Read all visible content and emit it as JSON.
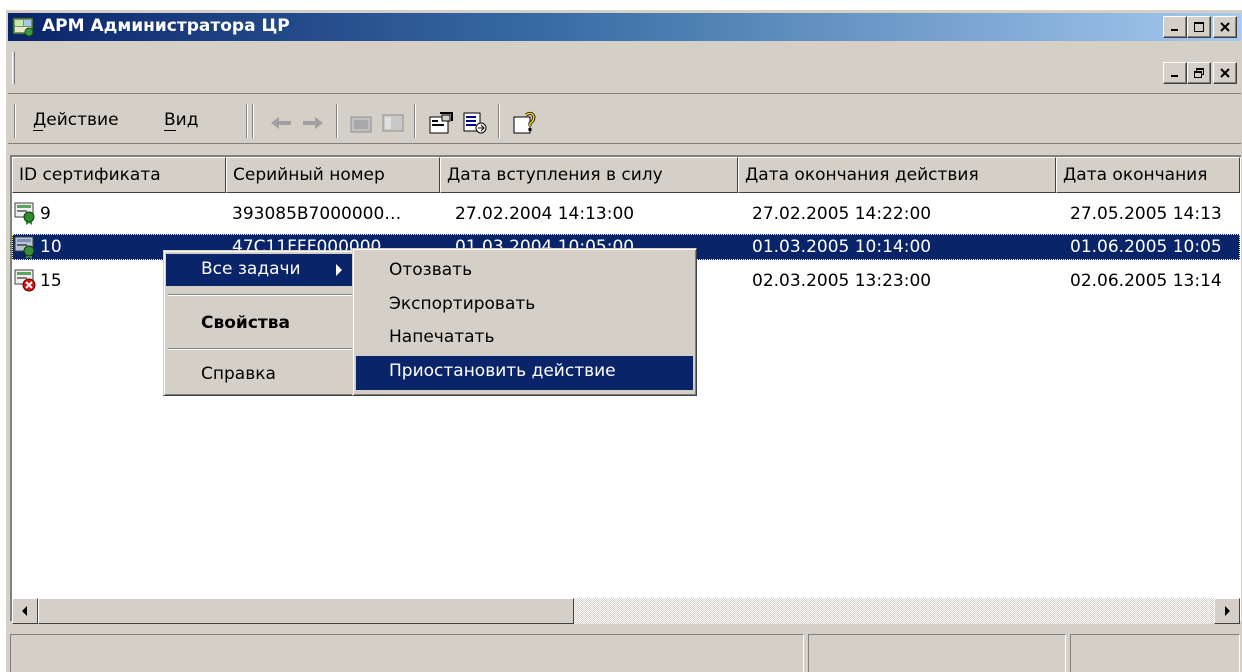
{
  "window": {
    "title": "АРМ Администратора ЦР",
    "caption_buttons": [
      "minimize-icon",
      "maximize-icon",
      "close-icon"
    ],
    "mdi_buttons": [
      "minimize-icon",
      "restore-icon",
      "close-icon"
    ]
  },
  "menu": {
    "action_label": "Действие",
    "view_label": "Вид"
  },
  "toolbar": {
    "icons": [
      "back-arrow-icon",
      "forward-arrow-icon",
      "folder-up-icon",
      "show-tree-icon",
      "properties-icon",
      "export-list-icon",
      "help-icon"
    ]
  },
  "list": {
    "columns": [
      "ID сертификата",
      "Серийный номер",
      "Дата вступления в силу",
      "Дата окончания действия",
      "Дата окончания"
    ],
    "rows": [
      {
        "icon": "valid-certificate-icon",
        "id": "9",
        "serial": "393085B7000000…",
        "valid_from": "27.02.2004 14:13:00",
        "valid_to": "27.02.2005 14:22:00",
        "end": "27.05.2005 14:13",
        "selected": false
      },
      {
        "icon": "suspended-certificate-icon",
        "id": "10",
        "serial": "47C11FFF000000…",
        "valid_from": "01.03.2004 10:05:00",
        "valid_to": "01.03.2005 10:14:00",
        "end": "01.06.2005 10:05",
        "selected": true
      },
      {
        "icon": "revoked-certificate-icon",
        "id": "15",
        "serial": "",
        "valid_from": "",
        "valid_to": "02.03.2005 13:23:00",
        "end": "02.06.2005 13:14",
        "selected": false
      }
    ]
  },
  "context_menu": {
    "all_tasks": "Все задачи",
    "properties": "Свойства",
    "help": "Справка"
  },
  "submenu": {
    "items": [
      "Отозвать",
      "Экспортировать",
      "Напечатать",
      "Приостановить действие"
    ],
    "highlighted_index": 3
  },
  "colors": {
    "selection": "#0a246a",
    "face": "#d4d0c8"
  }
}
